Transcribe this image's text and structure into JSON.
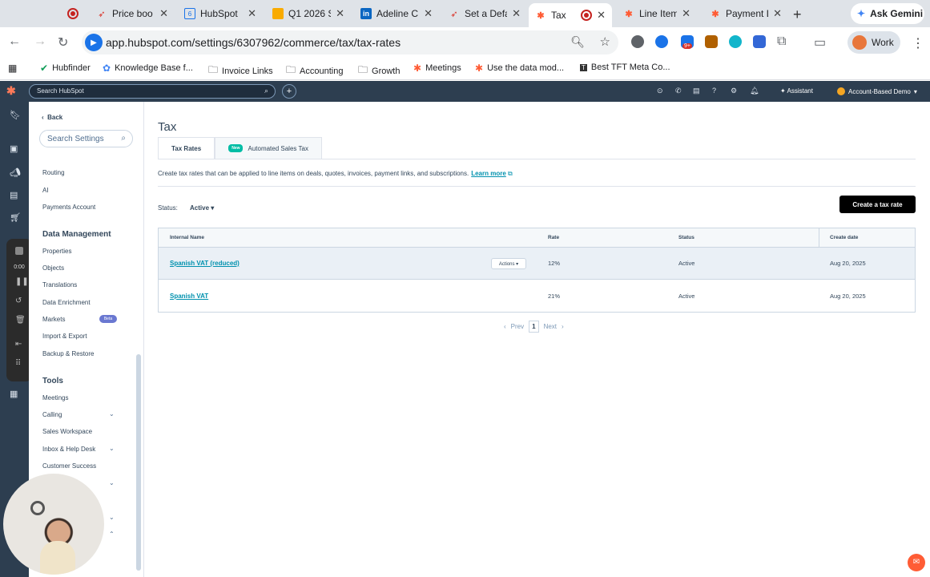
{
  "browser": {
    "tabs": [
      {
        "title": "",
        "icon": "record-icon",
        "active": false
      },
      {
        "title": "Price boo",
        "icon": "rocket-icon",
        "active": false
      },
      {
        "title": "HubSpot",
        "icon": "square-six-icon",
        "active": false
      },
      {
        "title": "Q1 2026 S",
        "icon": "slides-icon",
        "active": false
      },
      {
        "title": "Adeline C",
        "icon": "linkedin-icon",
        "active": false
      },
      {
        "title": "Set a Defa",
        "icon": "rocket-icon",
        "active": false
      },
      {
        "title": "Tax",
        "icon": "hubspot-icon",
        "active": true
      },
      {
        "title": "",
        "icon": "record-icon",
        "active": false
      },
      {
        "title": "Line Items",
        "icon": "hubspot-icon",
        "active": false
      },
      {
        "title": "Payment L",
        "icon": "hubspot-icon",
        "active": false
      }
    ],
    "gemini_label": "Ask Gemini",
    "url": "app.hubspot.com/settings/6307962/commerce/tax/tax-rates",
    "profile_label": "Work",
    "extension_badge": "9+",
    "bookmarks": [
      "Hubfinder",
      "Knowledge Base f...",
      "Invoice Links",
      "Accounting",
      "Growth",
      "Meetings",
      "Use the data mod...",
      "Best TFT Meta Co..."
    ]
  },
  "hubspot": {
    "search_placeholder": "Search HubSpot",
    "assistant_label": "Assistant",
    "account_label": "Account-Based Demo",
    "accent": "#ff7a59"
  },
  "recorder": {
    "time": "0:00"
  },
  "sidebar": {
    "back_label": "Back",
    "search_placeholder": "Search Settings",
    "items_top": [
      "Routing",
      "AI",
      "Payments Account"
    ],
    "data_management_heading": "Data Management",
    "data_management_items": [
      "Properties",
      "Objects",
      "Translations",
      "Data Enrichment",
      "Markets",
      "Import & Export",
      "Backup & Restore"
    ],
    "markets_badge": "Beta",
    "tools_heading": "Tools",
    "tools_items": [
      "Meetings",
      "Calling",
      "Sales Workspace",
      "Inbox & Help Desk",
      "Customer Success"
    ]
  },
  "main": {
    "title": "Tax",
    "tabs": [
      {
        "label": "Tax Rates",
        "active": true
      },
      {
        "label": "Automated Sales Tax",
        "badge": "New",
        "active": false
      }
    ],
    "description": "Create tax rates that can be applied to line items on deals, quotes, invoices, payment links, and subscriptions.",
    "learn_more": "Learn more",
    "status_label": "Status:",
    "status_value": "Active",
    "create_button": "Create a tax rate",
    "table": {
      "columns": [
        "Internal Name",
        "Rate",
        "Status",
        "Create date"
      ],
      "actions_label": "Actions",
      "rows": [
        {
          "name": "Spanish VAT (reduced)",
          "rate": "12%",
          "status": "Active",
          "created": "Aug 20, 2025"
        },
        {
          "name": "Spanish VAT",
          "rate": "21%",
          "status": "Active",
          "created": "Aug 20, 2025"
        }
      ]
    },
    "pager": {
      "prev": "Prev",
      "current": "1",
      "next": "Next"
    }
  }
}
